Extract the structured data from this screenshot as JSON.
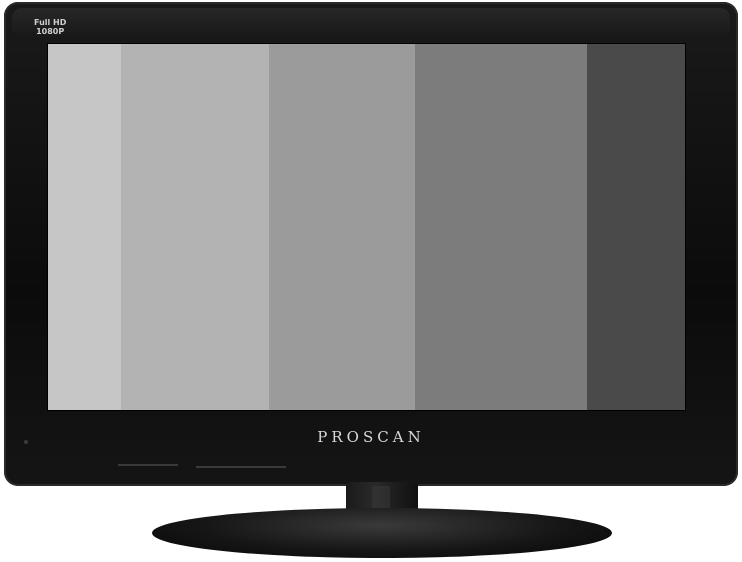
{
  "tv": {
    "brand": "PROSCAN",
    "badge_line1": "Full HD",
    "badge_line2": "1080P",
    "bezel_color": "#111111",
    "screen_bars": [
      "#c6c6c6",
      "#b3b3b3",
      "#9b9b9b",
      "#7c7c7c",
      "#4a4a4a"
    ]
  }
}
